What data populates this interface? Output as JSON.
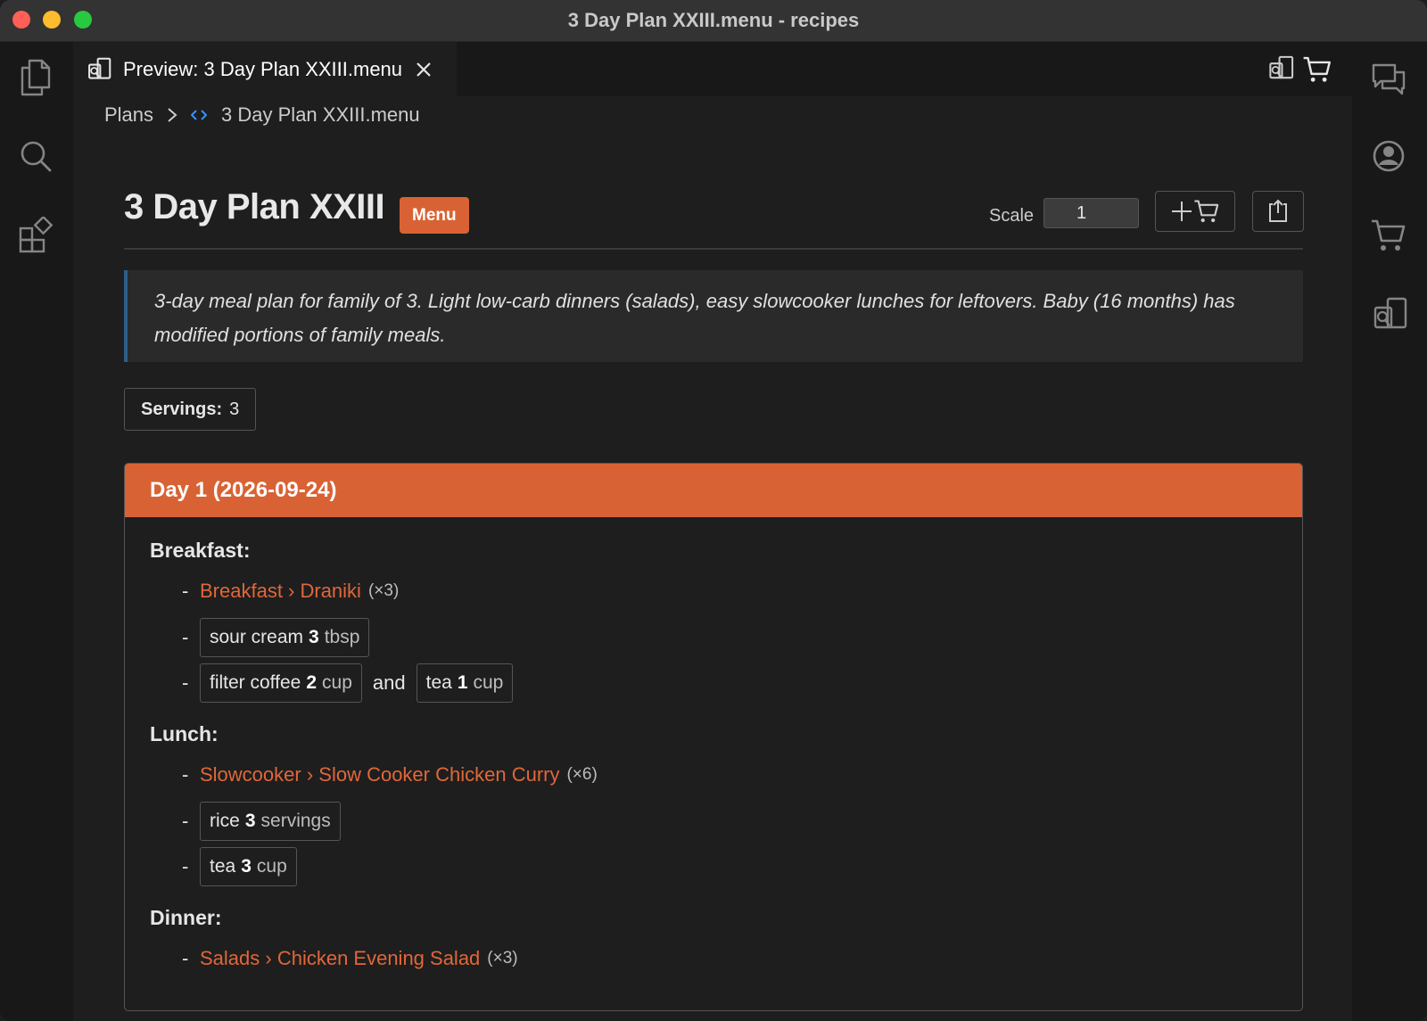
{
  "window": {
    "title": "3 Day Plan XXIII.menu - recipes"
  },
  "tab": {
    "label": "Preview: 3 Day Plan XXIII.menu"
  },
  "breadcrumb": {
    "folder": "Plans",
    "file": "3 Day Plan XXIII.menu"
  },
  "activity_left": [
    "files-icon",
    "search-icon",
    "extensions-icon"
  ],
  "activity_right": [
    "chat-icon",
    "account-icon",
    "cart-icon",
    "preview-icon"
  ],
  "page": {
    "title": "3 Day Plan XXIII",
    "badge": "Menu",
    "scale_label": "Scale",
    "scale_value": "1",
    "description": "3-day meal plan for family of 3. Light low-carb dinners (salads), easy slowcooker lunches for leftovers. Baby (16 months) has modified portions of family meals.",
    "servings_label": "Servings:",
    "servings_value": "3"
  },
  "day": {
    "header": "Day 1 (2026-09-24)",
    "meals": {
      "breakfast": {
        "label": "Breakfast:",
        "recipe": {
          "text": "Breakfast › Draniki",
          "mult": "(×3)"
        },
        "ingredient1": {
          "name": "sour cream",
          "qty": "3",
          "unit": "tbsp"
        },
        "ingredient2": {
          "name": "filter coffee",
          "qty": "2",
          "unit": "cup"
        },
        "joiner": "and",
        "ingredient3": {
          "name": "tea",
          "qty": "1",
          "unit": "cup"
        }
      },
      "lunch": {
        "label": "Lunch:",
        "recipe": {
          "text": "Slowcooker › Slow Cooker Chicken Curry",
          "mult": "(×6)"
        },
        "ingredient1": {
          "name": "rice",
          "qty": "3",
          "unit": "servings"
        },
        "ingredient2": {
          "name": "tea",
          "qty": "3",
          "unit": "cup"
        }
      },
      "dinner": {
        "label": "Dinner:",
        "recipe": {
          "text": "Salads › Chicken Evening Salad",
          "mult": "(×3)"
        }
      }
    }
  },
  "colors": {
    "accent": "#d96234",
    "link": "#e0673a",
    "quote_bar": "#2f5d8a"
  }
}
